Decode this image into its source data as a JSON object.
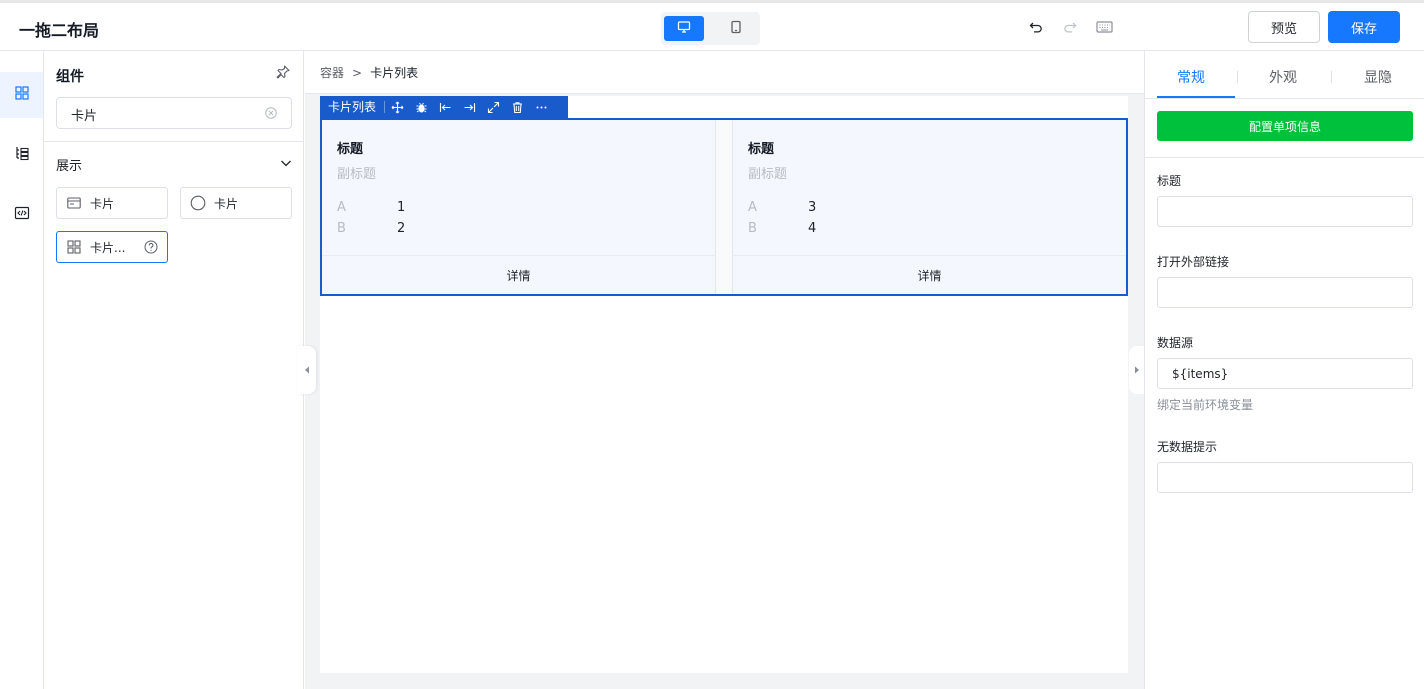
{
  "app": {
    "title": "一拖二布局"
  },
  "header": {
    "preview_label": "预览",
    "save_label": "保存"
  },
  "device": {
    "selected": "desktop",
    "options": [
      "desktop-icon",
      "tablet-icon"
    ]
  },
  "rail": {
    "items": [
      "components-icon",
      "outline-icon",
      "code-icon"
    ],
    "active": 0
  },
  "panel": {
    "title": "组件",
    "search": {
      "value": "卡片",
      "placeholder": ""
    },
    "group": "展示",
    "components": [
      {
        "label": "卡片",
        "icon": "card-icon"
      },
      {
        "label": "卡片",
        "icon": "circle-icon"
      },
      {
        "label": "卡片...",
        "icon": "cards-grid-icon",
        "selected": true
      }
    ]
  },
  "canvas": {
    "breadcrumb": [
      "容器",
      "卡片列表"
    ],
    "breadcrumb_sep": ">",
    "selection_label": "卡片列表",
    "selection_tools": [
      "move-icon",
      "debug-icon",
      "align-left-icon",
      "align-right-icon",
      "expand-icon",
      "delete-icon",
      "more-icon"
    ],
    "cards": [
      {
        "title": "标题",
        "subtitle": "副标题",
        "rows": [
          {
            "k": "A",
            "v": "1"
          },
          {
            "k": "B",
            "v": "2"
          }
        ],
        "footer": "详情"
      },
      {
        "title": "标题",
        "subtitle": "副标题",
        "rows": [
          {
            "k": "A",
            "v": "3"
          },
          {
            "k": "B",
            "v": "4"
          }
        ],
        "footer": "详情"
      }
    ]
  },
  "props": {
    "tabs": [
      "常规",
      "外观",
      "显隐"
    ],
    "active_tab": 0,
    "config_button": "配置单项信息",
    "fields": [
      {
        "label": "标题",
        "value": ""
      },
      {
        "label": "打开外部链接",
        "value": ""
      },
      {
        "label": "数据源",
        "value": "${items}",
        "hint": "绑定当前环境变量"
      },
      {
        "label": "无数据提示",
        "value": ""
      }
    ]
  },
  "colors": {
    "accent": "#1677ff",
    "config": "#00c13b",
    "selection": "#1a5bcc"
  }
}
